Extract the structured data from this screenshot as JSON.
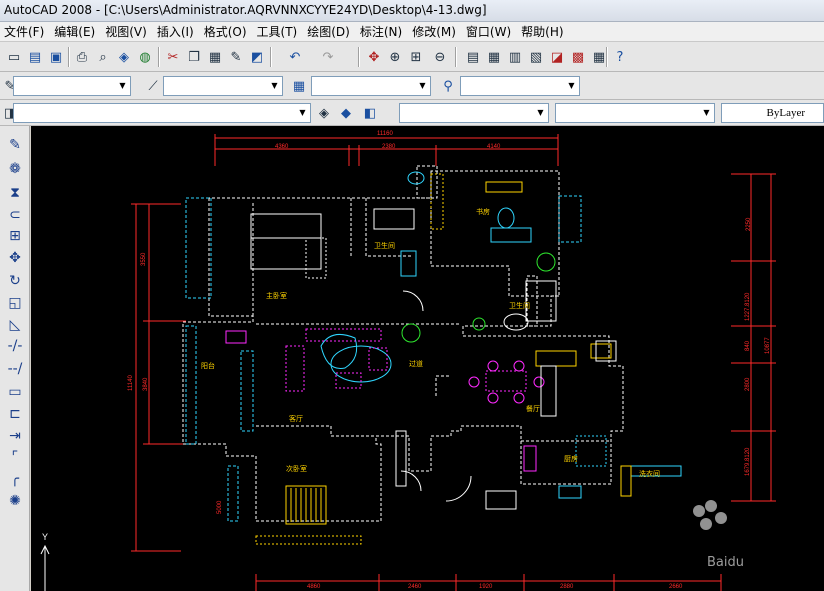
{
  "window": {
    "title": "AutoCAD 2008 - [C:\\Users\\Administrator.AQRVNNXCYYE24YD\\Desktop\\4-13.dwg]"
  },
  "menubar": {
    "items": [
      "文件(F)",
      "编辑(E)",
      "视图(V)",
      "插入(I)",
      "格式(O)",
      "工具(T)",
      "绘图(D)",
      "标注(N)",
      "修改(M)",
      "窗口(W)",
      "帮助(H)"
    ]
  },
  "toolbar": {
    "linetype_value": "ByLayer"
  },
  "drawing": {
    "dimensions": {
      "overall_top": "11160",
      "top_a": "4360",
      "top_b": "2380",
      "top_c": "4140",
      "left_a": "3550",
      "left_total": "11140",
      "left_b": "3840",
      "right_a": "2250",
      "right_b": "1227.8120",
      "right_total": "10877",
      "right_c": "840",
      "right_d": "2800",
      "right_e": "1679.8120",
      "bottom_a": "4860",
      "bottom_b": "2460",
      "bottom_c": "1920",
      "bottom_d": "2880",
      "bottom_e": "2660",
      "left_small": "5000"
    },
    "rooms": {
      "master_bedroom": "主卧室",
      "study": "书房",
      "kitchen_bath": "卫生间",
      "bathroom": "卫生间",
      "balcony": "阳台",
      "corridor": "过道",
      "living_room": "客厅",
      "dining_room": "餐厅",
      "second_bedroom": "次卧室",
      "kitchen": "厨房",
      "laundry": "洗衣间"
    },
    "axis_label": "Y",
    "watermark": "Baidu"
  },
  "colors": {
    "wall": "#ffffff",
    "dimension": "#ff2a2a",
    "furniture_cyan": "#2fd6ff",
    "furniture_magenta": "#ff2aff",
    "furniture_yellow": "#ffd400",
    "plant_green": "#2ee62e"
  }
}
